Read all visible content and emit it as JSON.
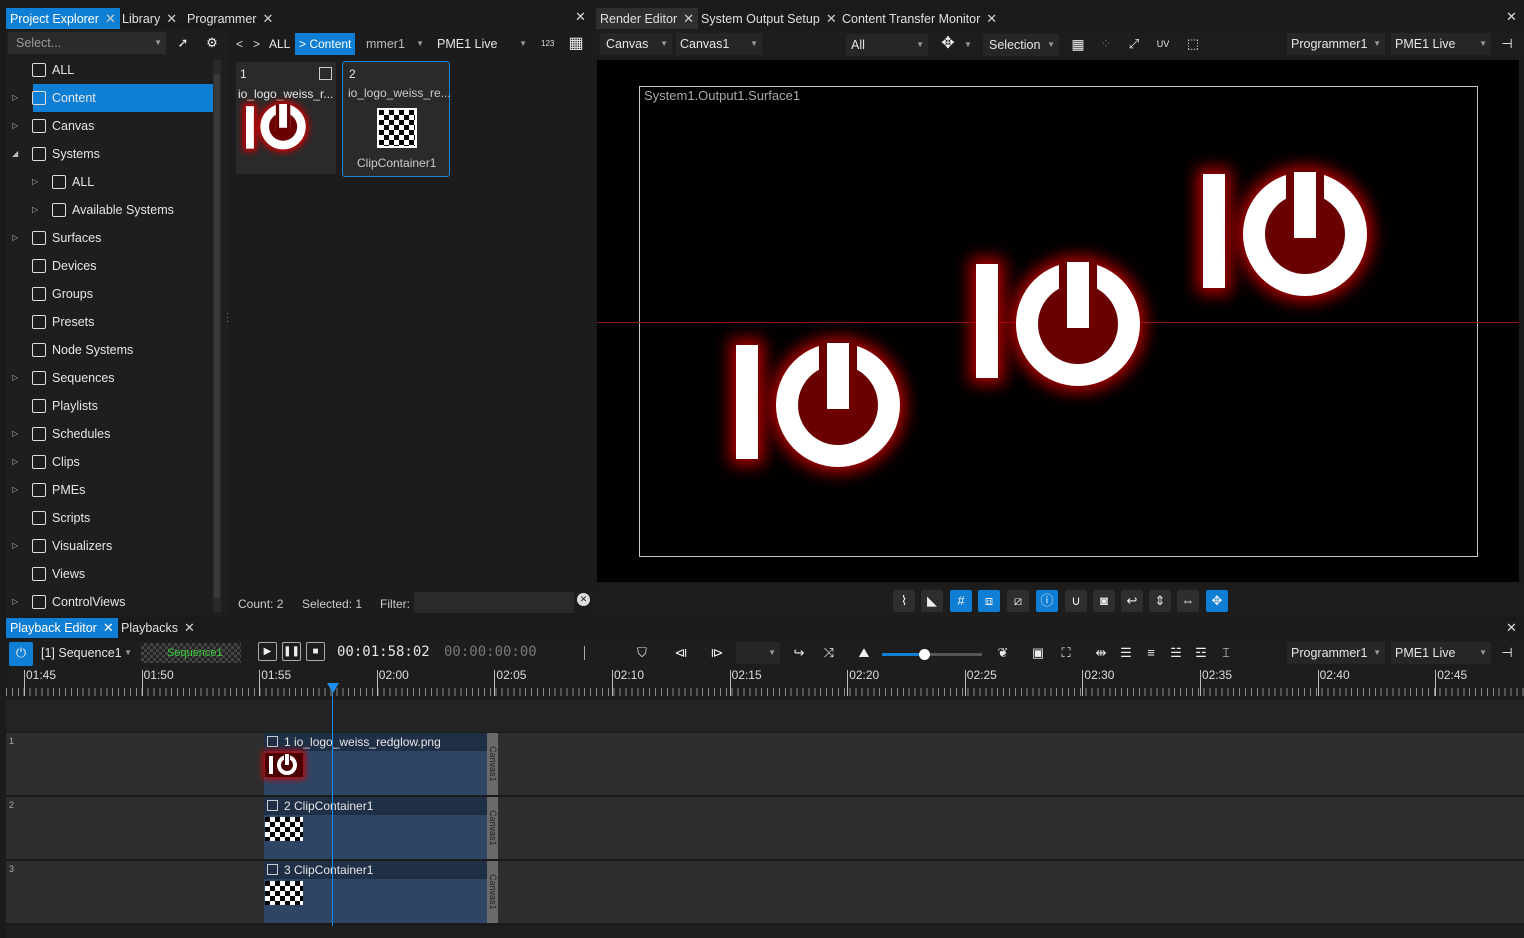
{
  "left_tabs": [
    {
      "label": "Project Explorer"
    },
    {
      "label": "Library"
    },
    {
      "label": "Programmer"
    }
  ],
  "right_tabs": [
    {
      "label": "Render Editor"
    },
    {
      "label": "System Output Setup"
    },
    {
      "label": "Content Transfer Monitor"
    }
  ],
  "bottom_tabs": [
    {
      "label": "Playback Editor"
    },
    {
      "label": "Playbacks"
    }
  ],
  "explorer": {
    "select_placeholder": "Select...",
    "tree": [
      {
        "label": "ALL",
        "icon": "database-icon"
      },
      {
        "label": "Content",
        "icon": "content-icon",
        "selected": true
      },
      {
        "label": "Canvas",
        "icon": "canvas-icon"
      },
      {
        "label": "Systems",
        "icon": "systems-icon"
      },
      {
        "label": "ALL",
        "icon": "database-icon"
      },
      {
        "label": "Available Systems",
        "icon": "systems-icon"
      },
      {
        "label": "Surfaces",
        "icon": "surface-icon"
      },
      {
        "label": "Devices",
        "icon": "devices-icon"
      },
      {
        "label": "Groups",
        "icon": "groups-icon"
      },
      {
        "label": "Presets",
        "icon": "presets-icon"
      },
      {
        "label": "Node Systems",
        "icon": "node-icon"
      },
      {
        "label": "Sequences",
        "icon": "sequence-icon"
      },
      {
        "label": "Playlists",
        "icon": "playlist-icon"
      },
      {
        "label": "Schedules",
        "icon": "calendar-icon"
      },
      {
        "label": "Clips",
        "icon": "clip-icon"
      },
      {
        "label": "PMEs",
        "icon": "pme-icon"
      },
      {
        "label": "Scripts",
        "icon": "script-icon"
      },
      {
        "label": "Visualizers",
        "icon": "cube-icon"
      },
      {
        "label": "Views",
        "icon": "view-icon"
      },
      {
        "label": "ControlViews",
        "icon": "control-icon"
      }
    ]
  },
  "content_panel": {
    "nav_back": "<",
    "nav_fwd": ">",
    "crumb_all": "ALL",
    "crumb_content": "> Content",
    "programmer": "mmer1",
    "pme": "PME1 Live",
    "num_toggle": "123",
    "items": [
      {
        "index": "1",
        "name": "io_logo_weiss_r..."
      },
      {
        "index": "2",
        "name": "io_logo_weiss_re...",
        "sub": "ClipContainer1"
      }
    ],
    "status_count": "Count: 2",
    "status_selected": "Selected: 1",
    "filter_label": "Filter:"
  },
  "render_editor": {
    "mode": "Canvas",
    "canvas": "Canvas1",
    "layer": "All",
    "tool": "Selection",
    "programmer": "Programmer1",
    "pme": "PME1 Live",
    "surface_label": "System1.Output1.Surface1",
    "logo_glyph": "IO"
  },
  "playback": {
    "sequence": "[1] Sequence1",
    "sequence_name": "Sequence1",
    "timecode": "00:01:58:02",
    "timecode2": "00:00:00:00",
    "programmer": "Programmer1",
    "pme": "PME1 Live",
    "ticks": [
      "01:45",
      "01:50",
      "01:55",
      "02:00",
      "02:05",
      "02:10",
      "02:15",
      "02:20",
      "02:25",
      "02:30",
      "02:35",
      "02:40",
      "02:45"
    ],
    "slider_value": 0.42,
    "tracks": [
      {
        "num": "1",
        "clip": "1 io_logo_weiss_redglow.png",
        "canvas": "Canvas1"
      },
      {
        "num": "2",
        "clip": "2 ClipContainer1",
        "canvas": "Canvas1"
      },
      {
        "num": "3",
        "clip": "3 ClipContainer1",
        "canvas": "Canvas1"
      }
    ]
  },
  "colors": {
    "accent": "#0e7fd4",
    "logo_red": "#6b0000"
  }
}
